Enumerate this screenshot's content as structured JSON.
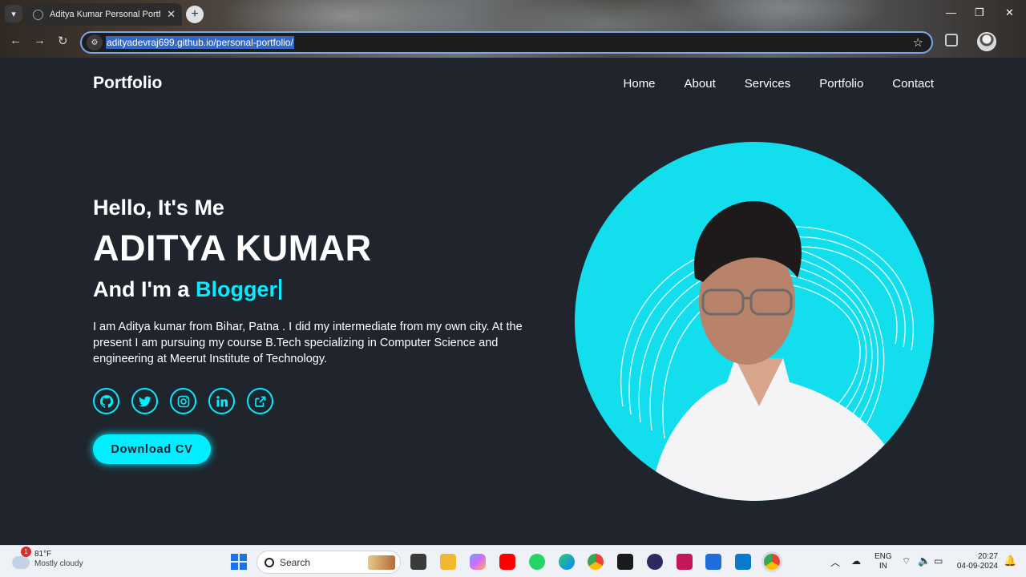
{
  "browser": {
    "tab_title": "Aditya Kumar Personal Portfolio",
    "url": "adityadevraj699.github.io/personal-portfolio/"
  },
  "site": {
    "logo": "Portfolio",
    "nav": [
      "Home",
      "About",
      "Services",
      "Portfolio",
      "Contact"
    ],
    "hello": "Hello, It's Me",
    "name": "ADITYA KUMAR",
    "role_prefix": "And I'm a",
    "role_value": "Blogger",
    "bio_lines": [
      "I am Aditya kumar from Bihar, Patna . I did my intermediate from my own city. At the",
      "present I am pursuing my course B.Tech specializing in Computer Science and",
      "engineering at Meerut Institute of Technology."
    ],
    "socials": [
      "github-icon",
      "twitter-icon",
      "instagram-icon",
      "linkedin-icon",
      "external-link-icon"
    ],
    "cv_button": "Download CV",
    "accent_color": "#00eeff",
    "background_color": "#1f242d"
  },
  "taskbar": {
    "weather_temp": "81°F",
    "weather_desc": "Mostly cloudy",
    "weather_badge": "1",
    "search_placeholder": "Search",
    "lang": "ENG",
    "region": "IN",
    "time": "20:27",
    "date": "04-09-2024"
  }
}
